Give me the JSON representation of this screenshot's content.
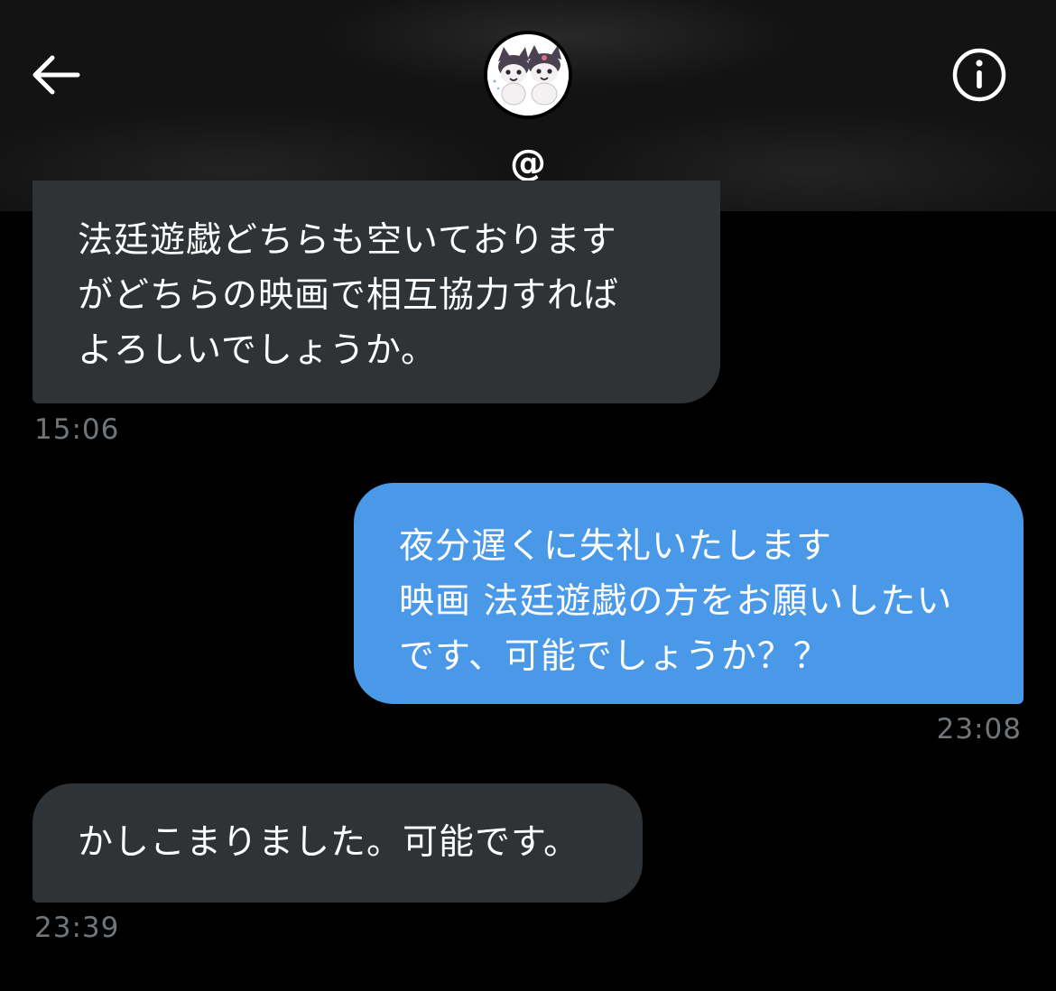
{
  "header": {
    "handle": "@"
  },
  "messages": [
    {
      "direction": "received",
      "lines": [
        "法廷遊戯どちらも空いております",
        "がどちらの映画で相互協力すれば",
        "よろしいでしょうか。"
      ],
      "time": "15:06"
    },
    {
      "direction": "sent",
      "lines": [
        "夜分遅くに失礼いたします",
        "映画 法廷遊戯の方をお願いしたい",
        "です、可能でしょうか？？"
      ],
      "time": "23:08"
    },
    {
      "direction": "received",
      "lines": [
        "かしこまりました。可能です。"
      ],
      "time": "23:39"
    }
  ],
  "icons": {
    "back": "arrow-left-icon",
    "info": "info-circle-icon",
    "avatar": "avatar-image"
  },
  "colors": {
    "background": "#000000",
    "header": "#131313",
    "received_bubble": "#2f3336",
    "sent_bubble": "#4a99e9",
    "timestamp": "#71767b"
  }
}
